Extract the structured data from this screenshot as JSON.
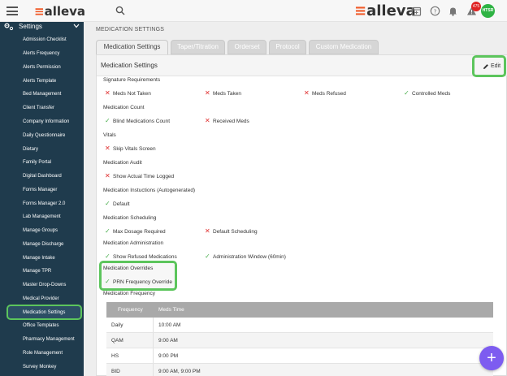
{
  "header": {
    "logo_left": "alleva",
    "logo_right": "alleva",
    "notification_count": "475",
    "avatar_initials": "HTSR"
  },
  "sidebar": {
    "section_label": "Settings",
    "items": [
      {
        "label": "Admission Checklist"
      },
      {
        "label": "Alerts Frequency"
      },
      {
        "label": "Alerts Permission"
      },
      {
        "label": "Alerts Template"
      },
      {
        "label": "Bed Management"
      },
      {
        "label": "Client Transfer"
      },
      {
        "label": "Company Information"
      },
      {
        "label": "Daily Questionnaire"
      },
      {
        "label": "Dietary"
      },
      {
        "label": "Family Portal"
      },
      {
        "label": "Digital Dashboard"
      },
      {
        "label": "Forms Manager"
      },
      {
        "label": "Forms Manager 2.0"
      },
      {
        "label": "Lab Management"
      },
      {
        "label": "Manage Groups"
      },
      {
        "label": "Manage Discharge"
      },
      {
        "label": "Manage Intake"
      },
      {
        "label": "Manage TPR"
      },
      {
        "label": "Master Drop-Downs"
      },
      {
        "label": "Medical Provider"
      },
      {
        "label": "Medication Settings"
      },
      {
        "label": "Office Templates"
      },
      {
        "label": "Pharmacy Management"
      },
      {
        "label": "Role Management"
      },
      {
        "label": "Survey Monkey"
      }
    ]
  },
  "main": {
    "page_title": "MEDICATION SETTINGS",
    "tabs": [
      "Medication Settings",
      "Taper/Titration",
      "Orderset",
      "Protocol",
      "Custom Medication"
    ],
    "card_title": "Medication Settings",
    "edit_label": "Edit",
    "sections": {
      "signature": {
        "label": "Signature Requirements",
        "options": [
          "Meds Not Taken",
          "Meds Taken",
          "Meds Refused",
          "Controlled Meds"
        ]
      },
      "count": {
        "label": "Medication Count",
        "options": [
          "Blind Medications Count",
          "Received Meds"
        ]
      },
      "vitals": {
        "label": "Vitals",
        "options": [
          "Skip Vitals Screen"
        ]
      },
      "audit": {
        "label": "Medication Audit",
        "options": [
          "Show Actual Time Logged"
        ]
      },
      "instructions": {
        "label": "Medication Instuctions (Autogenerated)",
        "options": [
          "Default"
        ]
      },
      "scheduling": {
        "label": "Medication Scheduling",
        "options": [
          "Max Dosage Required",
          "Default Scheduling"
        ]
      },
      "administration": {
        "label": "Medication Administration",
        "options": [
          "Show Refused Medications",
          "Administration Window (60min)"
        ]
      },
      "overrides": {
        "label": "Medication Overrides",
        "options": [
          "PRN Frequency Override"
        ]
      },
      "frequency": {
        "label": "Medication Frequency"
      }
    },
    "frequency_table": {
      "headers": [
        "Frequency",
        "Meds Time"
      ],
      "rows": [
        [
          "Daily",
          "10:00 AM"
        ],
        [
          "QAM",
          "9:00 AM"
        ],
        [
          "HS",
          "9:00 PM"
        ],
        [
          "BID",
          "9:00 AM, 9:00 PM"
        ]
      ]
    }
  },
  "fab_label": "+",
  "colors": {
    "accent": "#f05a28",
    "sidebar_bg": "#1f3b4d",
    "highlight": "#5cc55c",
    "fab": "#7d5cf0",
    "check": "#4caf50",
    "cross": "#e03131"
  }
}
